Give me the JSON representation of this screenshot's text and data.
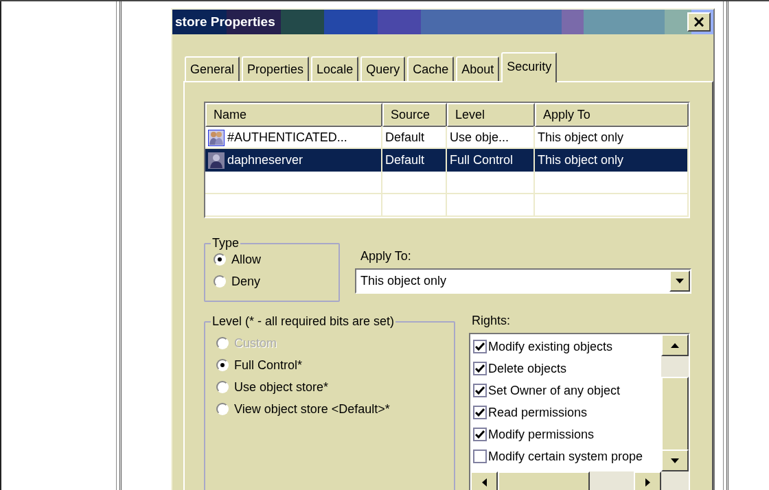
{
  "window": {
    "title": "store Properties"
  },
  "tabs": [
    {
      "label": "General",
      "selected": false
    },
    {
      "label": "Properties",
      "selected": false
    },
    {
      "label": "Locale",
      "selected": false
    },
    {
      "label": "Query",
      "selected": false
    },
    {
      "label": "Cache",
      "selected": false
    },
    {
      "label": "About",
      "selected": false
    },
    {
      "label": "Security",
      "selected": true
    }
  ],
  "list": {
    "columns": [
      "Name",
      "Source",
      "Level",
      "Apply To"
    ],
    "rows": [
      {
        "kind": "group",
        "name": "#AUTHENTICATED...",
        "source": "Default",
        "level": "Use obje...",
        "apply_to": "This object only",
        "selected": false
      },
      {
        "kind": "user",
        "name": "daphneserver",
        "source": "Default",
        "level": "Full Control",
        "apply_to": "This object only",
        "selected": true
      }
    ]
  },
  "type_group": {
    "label": "Type",
    "options": [
      {
        "label": "Allow",
        "selected": true
      },
      {
        "label": "Deny",
        "selected": false
      }
    ]
  },
  "apply_to": {
    "label": "Apply To:",
    "value": "This object only"
  },
  "level_group": {
    "label": "Level (* - all required bits are set)",
    "options": [
      {
        "label": "Custom",
        "selected": false,
        "disabled": true
      },
      {
        "label": "Full Control*",
        "selected": true,
        "disabled": false
      },
      {
        "label": "Use object store*",
        "selected": false,
        "disabled": false
      },
      {
        "label": "View object store <Default>*",
        "selected": false,
        "disabled": false
      }
    ]
  },
  "rights": {
    "label": "Rights:",
    "items": [
      {
        "label": "Modify existing objects",
        "checked": true
      },
      {
        "label": "Delete objects",
        "checked": true
      },
      {
        "label": "Set Owner of any object",
        "checked": true
      },
      {
        "label": "Read permissions",
        "checked": true
      },
      {
        "label": "Modify permissions",
        "checked": true
      },
      {
        "label": "Modify certain system prope",
        "checked": false
      }
    ]
  }
}
